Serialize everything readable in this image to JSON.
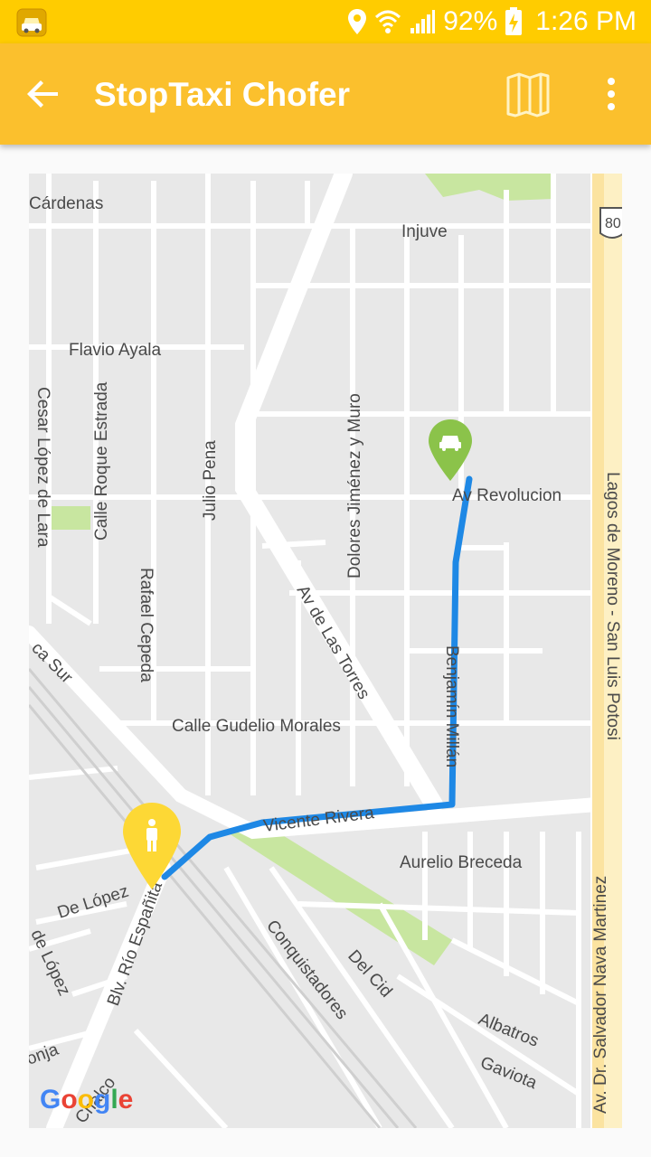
{
  "status_bar": {
    "battery": "92%",
    "time": "1:26 PM",
    "icons": [
      "taxi-app-icon",
      "location-icon",
      "wifi-icon",
      "signal-icon",
      "battery-charging-icon"
    ]
  },
  "app_bar": {
    "title": "StopTaxi Chofer",
    "icons": [
      "back-arrow-icon",
      "map-icon",
      "more-vert-icon"
    ]
  },
  "map": {
    "streets": {
      "cardenas": "Cárdenas",
      "injuve": "Injuve",
      "flavio_ayala": "Flavio Ayala",
      "cesar_lopez": "Cesar López de Lara",
      "roque_estrada": "Calle Roque Estrada",
      "julio_pena": "Julio Pena",
      "dolores": "Dolores Jiménez y Muro",
      "revolucion": "Av Revolucion",
      "rafael_cepeda": "Rafael Cepeda",
      "las_torres": "Av de Las Torres",
      "benjamin_millan": "Benjamín Millán",
      "gudelio": "Calle Gudelio Morales",
      "vicente_rivera": "Vicente Rivera",
      "aurelio": "Aurelio Breceda",
      "de_lopez": "De López",
      "de_lopez_2": "de López",
      "rio_espanita": "Blv. Río Españita",
      "conquistadores": "Conquistadores",
      "del_cid": "Del Cid",
      "albatros": "Albatros",
      "gaviota": "Gaviota",
      "chalco": "Chalco",
      "lagos": "Lagos de Moreno - San Luis Potosi",
      "salvador": "Av. Dr. Salvador Nava Martinez",
      "ca_sur": "ca Sur",
      "onja": "onja",
      "highway": "80"
    },
    "markers": [
      "taxi-marker-icon",
      "passenger-marker-icon"
    ],
    "route_color": "#1e88e5",
    "logo": "Google"
  },
  "colors": {
    "status_bar": "#ffcc00",
    "app_bar": "#fbc02d",
    "taxi_marker": "#8bc34a",
    "passenger_marker": "#fdd835"
  }
}
